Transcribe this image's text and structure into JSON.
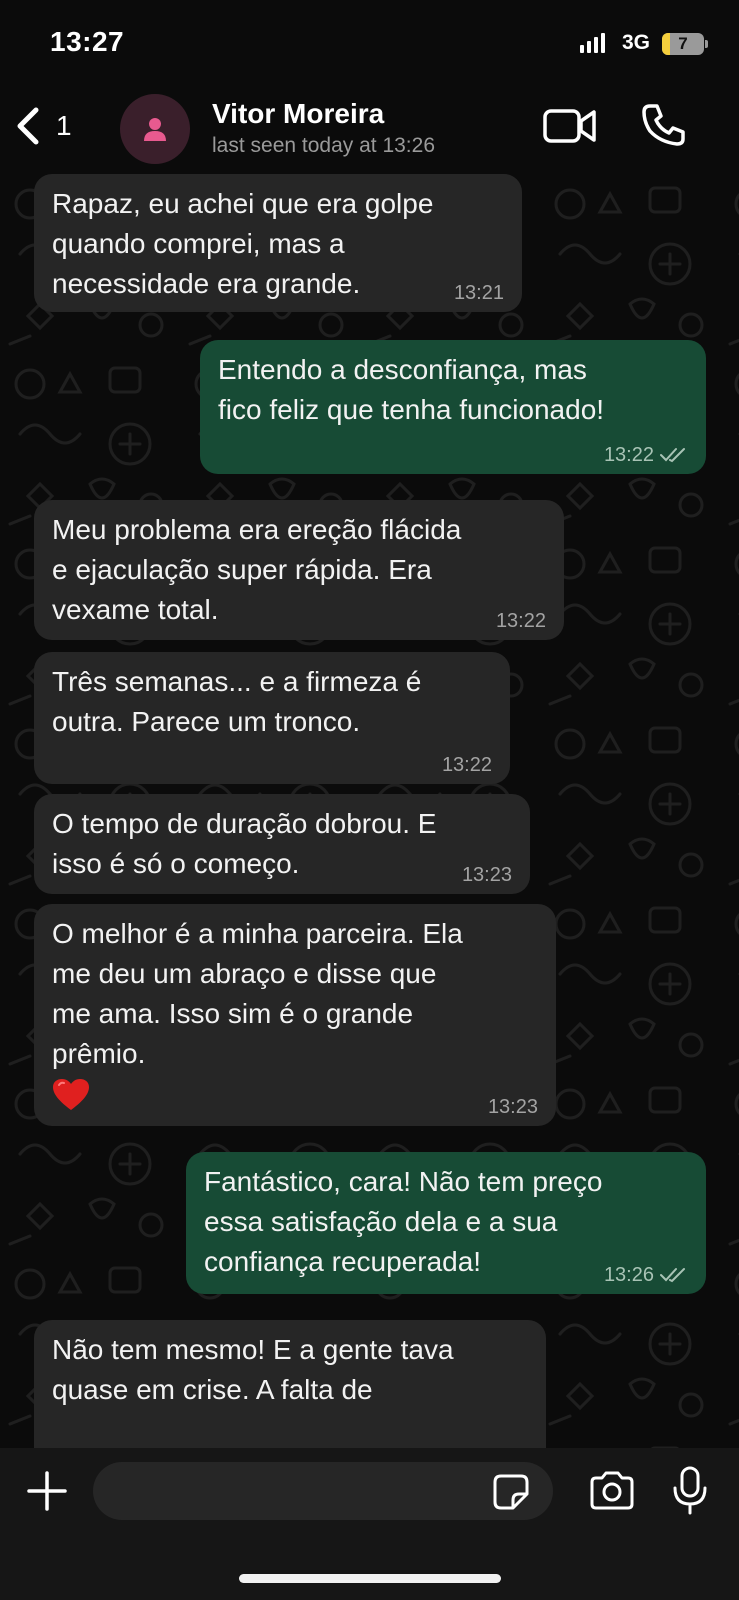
{
  "status_bar": {
    "time": "13:27",
    "network": "3G",
    "battery_level": "7",
    "battery_fraction": 0.2
  },
  "header": {
    "back_count": "1",
    "contact_name": "Vitor Moreira",
    "contact_status": "last seen today at 13:26",
    "icons": {
      "back": "chevron-left-icon",
      "avatar": "person-icon",
      "video": "video-camera-icon",
      "call": "phone-icon"
    }
  },
  "messages": [
    {
      "direction": "in",
      "lines": [
        "Rapaz, eu achei que era golpe",
        "quando comprei, mas a",
        "necessidade era grande."
      ],
      "time": "13:21"
    },
    {
      "direction": "out",
      "lines": [
        "Entendo a desconfiança, mas",
        "fico feliz que tenha funcionado!"
      ],
      "time": "13:22",
      "status": "read"
    },
    {
      "direction": "in",
      "lines": [
        "Meu problema era ereção flácida",
        "e ejaculação super rápida. Era",
        "vexame total."
      ],
      "time": "13:22"
    },
    {
      "direction": "in",
      "lines": [
        "Três semanas... e a firmeza é",
        "outra. Parece um tronco."
      ],
      "time": "13:22"
    },
    {
      "direction": "in",
      "lines": [
        "O tempo de duração dobrou. E",
        "isso é só o começo."
      ],
      "time": "13:23"
    },
    {
      "direction": "in",
      "lines": [
        "O melhor é a minha parceira. Ela",
        "me deu um abraço e disse que",
        "me ama. Isso sim é o grande",
        "prêmio."
      ],
      "emoji": "❤️",
      "time": "13:23"
    },
    {
      "direction": "out",
      "lines": [
        "Fantástico, cara! Não tem preço",
        "essa satisfação dela e a sua",
        "confiança recuperada!"
      ],
      "time": "13:26",
      "status": "read"
    },
    {
      "direction": "in",
      "lines": [
        "Não tem mesmo! E a gente tava",
        "quase em crise. A falta de"
      ],
      "time": ""
    }
  ],
  "input_bar": {
    "placeholder": "",
    "icons": {
      "attach": "plus-icon",
      "sticker": "sticker-icon",
      "camera": "camera-icon",
      "mic": "microphone-icon"
    }
  },
  "colors": {
    "background": "#0b0b0b",
    "incoming_bubble": "#262626",
    "outgoing_bubble": "#174b35",
    "timestamp": "#a3a3a3"
  }
}
